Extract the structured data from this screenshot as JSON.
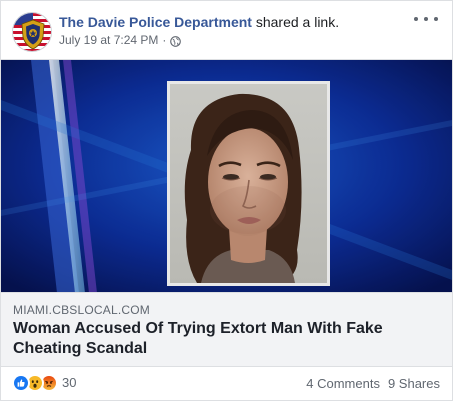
{
  "post": {
    "page_name": "The Davie Police Department",
    "action_text": " shared a link.",
    "timestamp": "July 19 at 7:24 PM",
    "separator": "·",
    "privacy_icon": "globe-icon",
    "more_icon": "more-options-icon"
  },
  "link": {
    "domain": "MIAMI.CBSLOCAL.COM",
    "headline": "Woman Accused Of Trying Extort Man With Fake Cheating Scandal"
  },
  "engagement": {
    "reaction_icons": [
      "like-reaction-icon",
      "wow-reaction-icon",
      "angry-reaction-icon"
    ],
    "reaction_count": "30",
    "comments": "4 Comments",
    "shares": "9 Shares"
  },
  "colors": {
    "page_name": "#385898",
    "like": "#1877f2",
    "wow": "#f7b928",
    "angry": "#e9710f",
    "caption_bg": "#f2f3f5"
  }
}
